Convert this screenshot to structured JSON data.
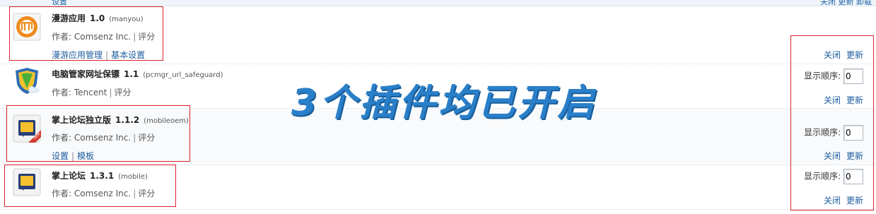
{
  "top_strip": {
    "left_link": "设置",
    "right_links": "关闭 更新 卸载"
  },
  "plugins": [
    {
      "name": "漫游应用",
      "version": "1.0",
      "id": "(manyou)",
      "author": "作者: Comsenz Inc.",
      "rate": "评分",
      "links": [
        "漫游应用管理",
        "基本设置"
      ],
      "actions": [
        "关闭",
        "更新"
      ],
      "icon": "manyou-icon"
    },
    {
      "name": "电脑管家网址保镖",
      "version": "1.1",
      "id": "(pcmgr_url_safeguard)",
      "author": "作者: Tencent",
      "rate": "评分",
      "order_label": "显示顺序:",
      "order_value": "0",
      "actions": [
        "关闭",
        "更新"
      ],
      "icon": "shield-icon"
    },
    {
      "name": "掌上论坛独立版",
      "version": "1.1.2",
      "id": "(mobileoem)",
      "author": "作者: Comsenz Inc.",
      "rate": "评分",
      "order_label": "显示顺序:",
      "order_value": "0",
      "links": [
        "设置",
        "模板"
      ],
      "actions": [
        "关闭",
        "更新"
      ],
      "icon": "mobile-oem-icon"
    },
    {
      "name": "掌上论坛",
      "version": "1.3.1",
      "id": "(mobile)",
      "author": "作者: Comsenz Inc.",
      "rate": "评分",
      "order_label": "显示顺序:",
      "order_value": "0",
      "actions": [
        "关闭",
        "更新"
      ],
      "icon": "mobile-icon"
    }
  ],
  "annotation": "3个插件均已开启",
  "colors": {
    "link": "#1d5c9e",
    "highlight_box": "#d9232a",
    "annotation": "#2a7fc9"
  }
}
